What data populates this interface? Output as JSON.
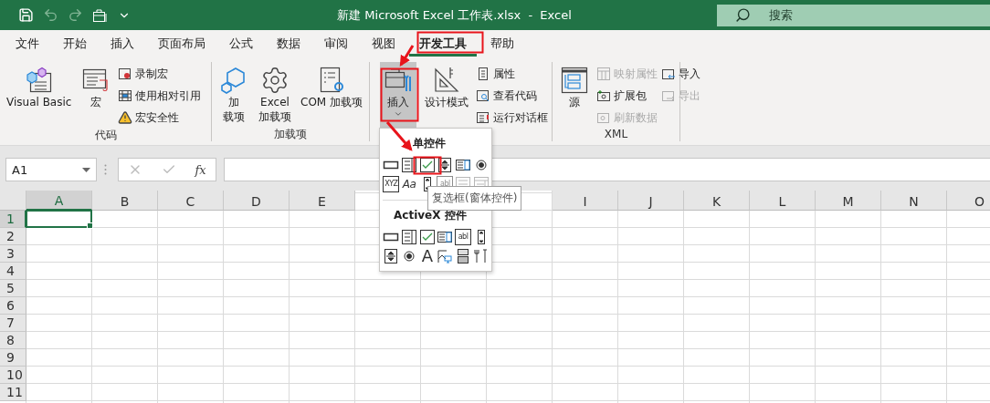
{
  "title_bar": {
    "title": "新建 Microsoft Excel 工作表.xlsx  -  Excel",
    "search": {
      "placeholder": "搜索"
    }
  },
  "ribbon_tabs": [
    {
      "label": "文件",
      "selected": false
    },
    {
      "label": "开始",
      "selected": false
    },
    {
      "label": "插入",
      "selected": false
    },
    {
      "label": "页面布局",
      "selected": false
    },
    {
      "label": "公式",
      "selected": false
    },
    {
      "label": "数据",
      "selected": false
    },
    {
      "label": "审阅",
      "selected": false
    },
    {
      "label": "视图",
      "selected": false
    },
    {
      "label": "开发工具",
      "selected": true
    },
    {
      "label": "帮助",
      "selected": false
    }
  ],
  "ribbon_groups": [
    {
      "label": "代码",
      "large_buttons": [
        {
          "kind": "visual-basic",
          "label": [
            "Visual Basic"
          ],
          "pressed": false,
          "has_menu": false
        },
        {
          "kind": "macro",
          "label": [
            "宏"
          ],
          "pressed": false,
          "has_menu": false
        }
      ],
      "small_columns": [
        [
          {
            "kind": "record",
            "label": "录制宏",
            "disabled": false
          },
          {
            "kind": "relative",
            "label": "使用相对引用",
            "disabled": false
          },
          {
            "kind": "security",
            "label": "宏安全性",
            "disabled": false
          }
        ]
      ]
    },
    {
      "label": "加载项",
      "large_buttons": [
        {
          "kind": "addins",
          "label": [
            "加",
            "载项"
          ],
          "pressed": false,
          "has_menu": false
        },
        {
          "kind": "excel-addins",
          "label": [
            "Excel",
            "加载项"
          ],
          "pressed": false,
          "has_menu": false
        },
        {
          "kind": "com-addins",
          "label": [
            "COM 加载项"
          ],
          "pressed": false,
          "has_menu": false
        }
      ]
    },
    {
      "large_buttons": [
        {
          "kind": "insert",
          "label": [
            "插入"
          ],
          "pressed": true,
          "has_menu": true
        },
        {
          "kind": "design",
          "label": [
            "设计模式"
          ],
          "pressed": false,
          "has_menu": false
        }
      ],
      "small_columns": [
        [
          {
            "kind": "properties",
            "label": "属性",
            "disabled": false
          },
          {
            "kind": "view-code",
            "label": "查看代码",
            "disabled": false
          },
          {
            "kind": "run-dialog",
            "label": "运行对话框",
            "disabled": false
          }
        ]
      ]
    },
    {
      "label": "XML",
      "large_buttons": [
        {
          "kind": "source",
          "label": [
            "源"
          ],
          "pressed": false,
          "has_menu": false
        }
      ],
      "small_columns": [
        [
          {
            "kind": "map",
            "label": "映射属性",
            "disabled": true
          },
          {
            "kind": "expansion",
            "label": "扩展包",
            "disabled": false
          },
          {
            "kind": "refresh",
            "label": "刷新数据",
            "disabled": true
          }
        ],
        [
          {
            "kind": "import",
            "label": "导入",
            "disabled": false
          },
          {
            "kind": "export",
            "label": "导出",
            "disabled": true
          }
        ]
      ]
    }
  ],
  "formula_bar": {
    "name_box": "A1",
    "function_button": "fx"
  },
  "sheet": {
    "columns": [
      {
        "label": "A",
        "selected": true
      },
      {
        "label": "B",
        "selected": false
      },
      {
        "label": "C",
        "selected": false
      },
      {
        "label": "D",
        "selected": false
      },
      {
        "label": "E",
        "selected": false
      },
      {
        "kind": "covered"
      },
      {
        "kind": "covered"
      },
      {
        "kind": "covered"
      },
      {
        "label": "I",
        "selected": false
      },
      {
        "label": "J",
        "selected": false
      },
      {
        "label": "K",
        "selected": false
      },
      {
        "label": "L",
        "selected": false
      },
      {
        "label": "M",
        "selected": false
      },
      {
        "label": "N",
        "selected": false
      },
      {
        "label": "O",
        "selected": false
      }
    ],
    "rows": [
      {
        "label": "1",
        "selected": true
      },
      {
        "label": "2",
        "selected": false
      },
      {
        "label": "3",
        "selected": false
      },
      {
        "label": "4",
        "selected": false
      },
      {
        "label": "5",
        "selected": false
      },
      {
        "label": "6",
        "selected": false
      },
      {
        "label": "7",
        "selected": false
      },
      {
        "label": "8",
        "selected": false
      },
      {
        "label": "9",
        "selected": false
      },
      {
        "label": "10",
        "selected": false
      },
      {
        "label": "11",
        "selected": false
      }
    ]
  },
  "insert_menu": {
    "sections": [
      {
        "title": "单控件",
        "rows": [
          [
            {
              "kind": "button",
              "disabled": false
            },
            {
              "kind": "combo",
              "disabled": false
            },
            {
              "kind": "checkbox",
              "disabled": false
            },
            {
              "kind": "spin",
              "disabled": false
            },
            {
              "kind": "listbox",
              "disabled": false
            },
            {
              "kind": "radio",
              "disabled": false
            }
          ],
          [
            {
              "kind": "group-box",
              "glyph": "XYZ",
              "disabled": false
            },
            {
              "kind": "label",
              "glyph": "Aa",
              "disabled": false
            },
            {
              "kind": "scrollbar",
              "disabled": false
            },
            {
              "kind": "textfield",
              "glyph": "abl",
              "disabled": true
            },
            {
              "kind": "combo-list",
              "disabled": true
            },
            {
              "kind": "combo-drop",
              "disabled": true
            }
          ]
        ]
      },
      {
        "title": "ActiveX 控件",
        "rows": [
          [
            {
              "kind": "button",
              "disabled": false
            },
            {
              "kind": "combo",
              "disabled": false
            },
            {
              "kind": "checkbox",
              "disabled": false
            },
            {
              "kind": "listbox",
              "disabled": false
            },
            {
              "kind": "textfield",
              "glyph": "abl",
              "disabled": false
            },
            {
              "kind": "scrollbar",
              "disabled": false
            }
          ],
          [
            {
              "kind": "spin",
              "disabled": false
            },
            {
              "kind": "radio",
              "disabled": false
            },
            {
              "kind": "big-label",
              "glyph": "A",
              "disabled": false
            },
            {
              "kind": "image",
              "disabled": false
            },
            {
              "kind": "toggle",
              "disabled": false
            },
            {
              "kind": "more",
              "disabled": false
            }
          ]
        ]
      }
    ],
    "tooltip": "复选框(窗体控件)"
  }
}
